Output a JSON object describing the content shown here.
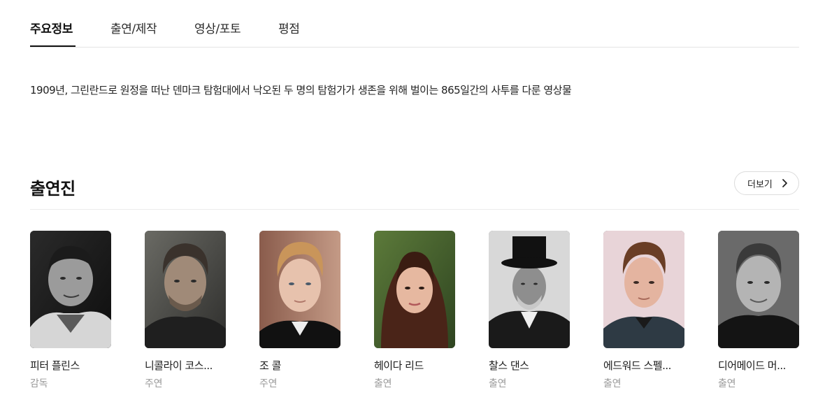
{
  "tabs": [
    {
      "label": "주요정보",
      "active": true
    },
    {
      "label": "출연/제작",
      "active": false
    },
    {
      "label": "영상/포토",
      "active": false
    },
    {
      "label": "평점",
      "active": false
    }
  ],
  "synopsis": "1909년, 그린란드로 원정을 떠난 덴마크 탐험대에서 낙오된 두 명의 탐험가가 생존을 위해 벌이는 865일간의 사투를 다룬 영상물",
  "cast_section": {
    "title": "출연진",
    "more_label": "더보기",
    "members": [
      {
        "name": "피터 플린스",
        "role": "감독"
      },
      {
        "name": "니콜라이 코스...",
        "role": "주연"
      },
      {
        "name": "조 콜",
        "role": "주연"
      },
      {
        "name": "헤이다 리드",
        "role": "출연"
      },
      {
        "name": "찰스 댄스",
        "role": "출연"
      },
      {
        "name": "에드워드 스펠...",
        "role": "출연"
      },
      {
        "name": "디어메이드 머...",
        "role": "출연"
      }
    ]
  }
}
